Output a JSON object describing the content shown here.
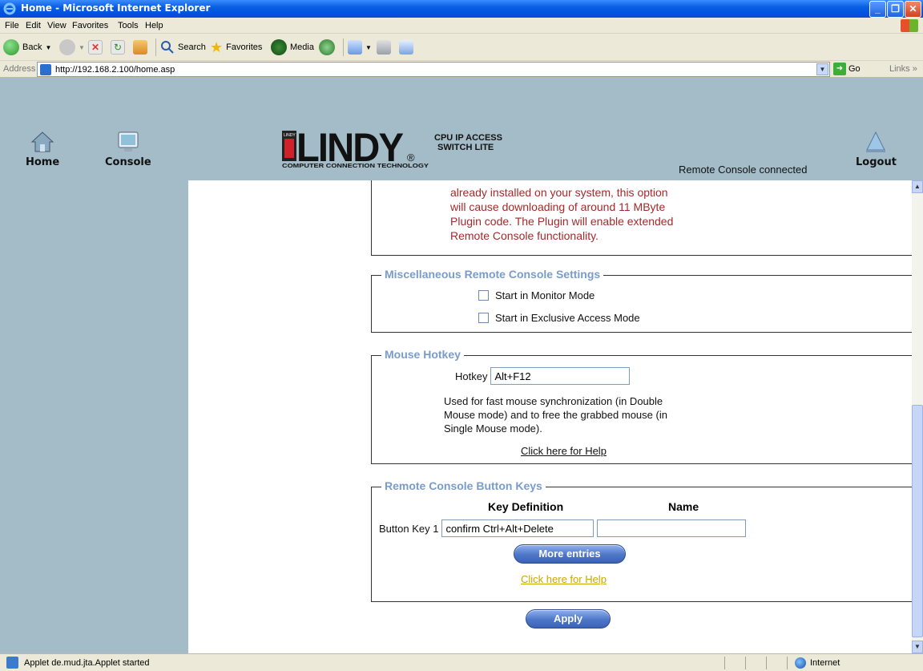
{
  "window": {
    "title": "Home - Microsoft Internet Explorer"
  },
  "menu": [
    "File",
    "Edit",
    "View",
    "Favorites",
    "Tools",
    "Help"
  ],
  "toolbar": {
    "back": "Back",
    "search": "Search",
    "favorites": "Favorites",
    "media": "Media"
  },
  "address": {
    "label": "Address",
    "url": "http://192.168.2.100/home.asp",
    "go": "Go",
    "links": "Links"
  },
  "header": {
    "nav": [
      {
        "label": "Home",
        "icon": "home-icon"
      },
      {
        "label": "Console",
        "icon": "console-icon"
      }
    ],
    "logout": "Logout",
    "logo": {
      "brand": "LINDY",
      "product_line1": "CPU IP ACCESS",
      "product_line2": "SWITCH LITE",
      "tagline": "COMPUTER CONNECTION TECHNOLOGY",
      "registered": "®",
      "badge": "LINDY"
    },
    "status": "Remote Console connected"
  },
  "plugin_note": {
    "lines": [
      "already installed on your system, this option",
      "will cause downloading of around 11 MByte",
      "Plugin code. The Plugin will enable extended",
      "Remote Console functionality."
    ]
  },
  "misc": {
    "legend": "Miscellaneous Remote Console Settings",
    "options": [
      {
        "label": "Start in Monitor Mode",
        "checked": false
      },
      {
        "label": "Start in Exclusive Access Mode",
        "checked": false
      }
    ]
  },
  "hotkey": {
    "legend": "Mouse Hotkey",
    "label": "Hotkey",
    "value": "Alt+F12",
    "description": [
      "Used for fast mouse synchronization (in Double",
      "Mouse mode) and to free the grabbed mouse (in",
      "Single Mouse mode)."
    ],
    "help": "Click here for Help"
  },
  "buttonkeys": {
    "legend": "Remote Console Button Keys",
    "col_definition": "Key Definition",
    "col_name": "Name",
    "rows": [
      {
        "label": "Button Key 1",
        "definition": "confirm Ctrl+Alt+Delete",
        "name": ""
      }
    ],
    "more": "More entries",
    "help": "Click here for Help"
  },
  "apply": "Apply",
  "statusbar": {
    "text": "Applet de.mud.jta.Applet started",
    "zone": "Internet"
  },
  "colors": {
    "page_bg": "#a3bcc8",
    "legend": "#7a9ccc",
    "warning": "#a42a2a",
    "help_link_yellow": "#c8a800"
  }
}
